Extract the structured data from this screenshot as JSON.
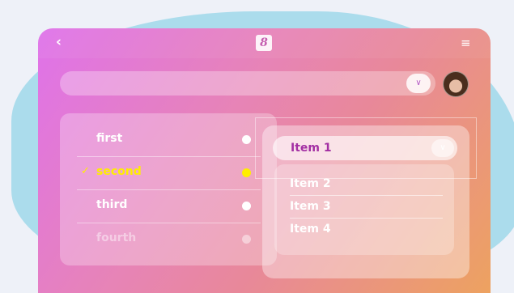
{
  "header": {
    "back_icon": "chevron-left-icon",
    "app_icon_glyph": "8",
    "menu_icon": "hamburger-icon"
  },
  "search": {
    "chevron_icon": "chevron-down-icon"
  },
  "list": {
    "items": [
      {
        "label": "first",
        "state": "normal"
      },
      {
        "label": "second",
        "state": "selected"
      },
      {
        "label": "third",
        "state": "normal"
      },
      {
        "label": "fourth",
        "state": "disabled"
      }
    ]
  },
  "dropdown": {
    "selected_label": "Item 1",
    "options": [
      "Item 2",
      "Item 3",
      "Item 4"
    ]
  },
  "colors": {
    "accent_selected": "#ffee00",
    "select_text": "#a32fa3",
    "gradient_start": "#df72ea",
    "gradient_end": "#eda260"
  }
}
